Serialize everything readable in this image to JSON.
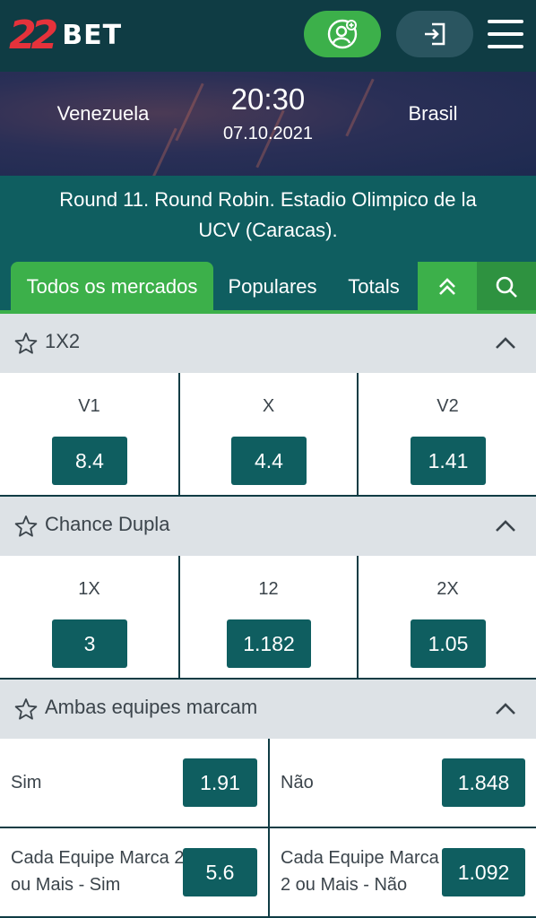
{
  "header": {
    "logo_number": "22",
    "logo_text": "BET",
    "icons": {
      "register": "user-plus-icon",
      "login": "login-icon",
      "menu": "hamburger-menu-icon"
    }
  },
  "match": {
    "home_team": "Venezuela",
    "away_team": "Brasil",
    "time": "20:30",
    "date": "07.10.2021",
    "info": "Round 11. Round Robin. Estadio Olimpico de la UCV (Caracas)."
  },
  "tabs": {
    "all": "Todos os mercados",
    "popular": "Populares",
    "totals": "Totals",
    "icons": {
      "collapse": "double-chevron-up-icon",
      "search": "search-icon"
    }
  },
  "markets": [
    {
      "title": "1X2",
      "outcomes": [
        {
          "label": "V1",
          "odd": "8.4"
        },
        {
          "label": "X",
          "odd": "4.4"
        },
        {
          "label": "V2",
          "odd": "1.41"
        }
      ]
    },
    {
      "title": "Chance Dupla",
      "outcomes": [
        {
          "label": "1X",
          "odd": "3"
        },
        {
          "label": "12",
          "odd": "1.182"
        },
        {
          "label": "2X",
          "odd": "1.05"
        }
      ]
    },
    {
      "title": "Ambas equipes marcam",
      "rows": [
        [
          {
            "label": "Sim",
            "odd": "1.91"
          },
          {
            "label": "Não",
            "odd": "1.848"
          }
        ],
        [
          {
            "label_line1": "Cada Equipe Marca 2",
            "label_line2": "ou Mais - Sim",
            "odd": "5.6"
          },
          {
            "label_line1": "Cada Equipe Marca",
            "label_line2": "2 ou Mais - Não",
            "odd": "1.092"
          }
        ]
      ]
    }
  ],
  "colors": {
    "topbar": "#0f3c44",
    "accent_green": "#3cb04a",
    "odd_button": "#0f5e60",
    "section_header": "#dde2e6"
  }
}
